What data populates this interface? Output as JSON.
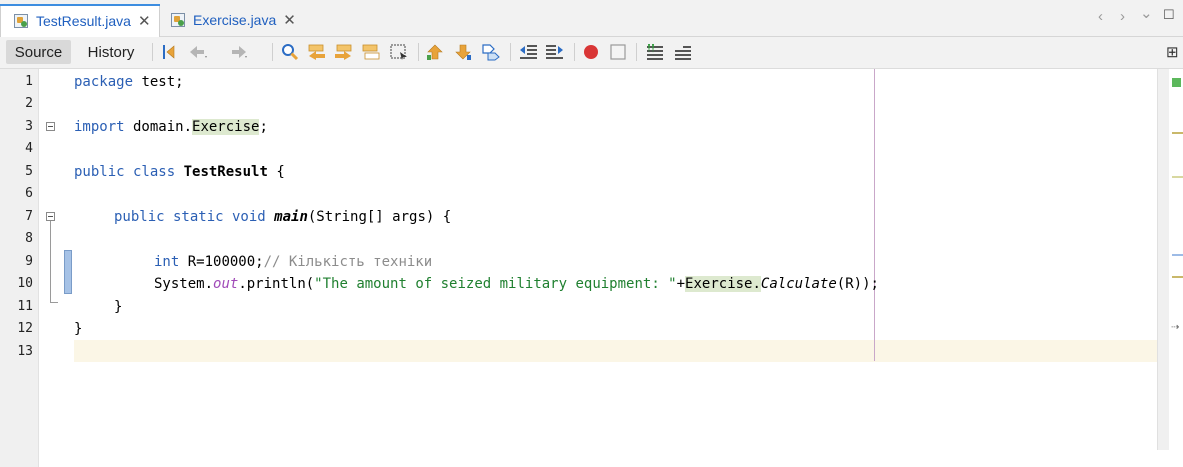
{
  "tabs": [
    {
      "label": "TestResult.java",
      "icon": "java-file-icon",
      "active": true
    },
    {
      "label": "Exercise.java",
      "icon": "java-file-icon",
      "active": false
    }
  ],
  "tab_nav": {
    "left": "‹",
    "right": "›",
    "down": "⌄",
    "restore": "☐"
  },
  "toolbar": {
    "source_label": "Source",
    "history_label": "History"
  },
  "editor": {
    "line_numbers": [
      "1",
      "2",
      "3",
      "4",
      "5",
      "6",
      "7",
      "8",
      "9",
      "10",
      "11",
      "12",
      "13"
    ],
    "lines": {
      "l1_kw": "package",
      "l1_rest": " test;",
      "l3_kw": "import",
      "l3_pkg": " domain.",
      "l3_cls": "Exercise",
      "l3_end": ";",
      "l5_kw": "public class",
      "l5_name": "TestResult",
      "l5_end": " {",
      "l7_kw": "public static void",
      "l7_name": "main",
      "l7_args": "(String[] args) {",
      "l9_kw": "int",
      "l9_rest": " R=100000;",
      "l9_cmt": "// Кількість техніки",
      "l10_sys": "System.",
      "l10_out": "out",
      "l10_call": ".println(",
      "l10_str": "\"The amount of seized military equipment: \"",
      "l10_plus": "+",
      "l10_cls": "Exercise",
      "l10_dot": ".",
      "l10_method": "Calculate",
      "l10_end": "(R));",
      "l11": "}",
      "l12": "}"
    }
  },
  "colors": {
    "keyword": "#2b5fb4",
    "string": "#208030",
    "comment": "#8c8c8c",
    "field": "#a04ab8",
    "highlight": "#dde9cf",
    "current_line": "#fbf6e6"
  }
}
